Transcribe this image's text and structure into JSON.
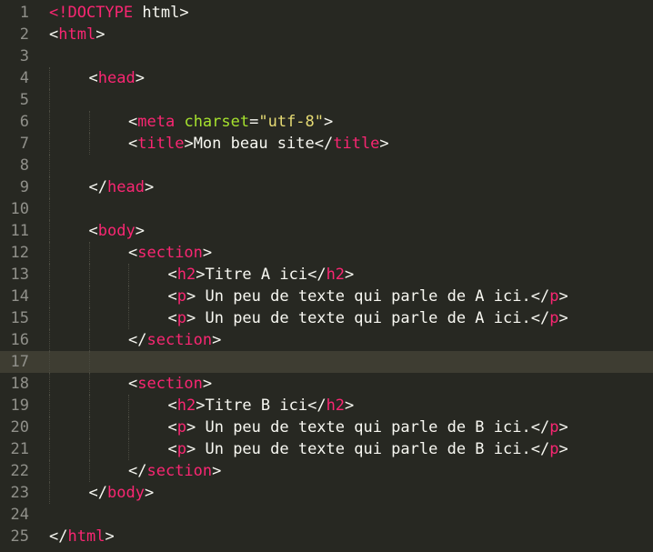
{
  "editor": {
    "active_line": 17,
    "colors": {
      "background": "#272822",
      "gutter_text": "#90908a",
      "tag": "#f92672",
      "attribute": "#a6e22e",
      "string": "#e6db74",
      "text": "#f8f8f2",
      "active_line": "#3e3d32"
    },
    "lines": [
      {
        "n": "1",
        "indent": 0,
        "tokens": [
          [
            "t",
            "<!DOCTYPE"
          ],
          [
            "x",
            " html"
          ],
          [
            "p",
            ">"
          ]
        ]
      },
      {
        "n": "2",
        "indent": 0,
        "tokens": [
          [
            "p",
            "<"
          ],
          [
            "t",
            "html"
          ],
          [
            "p",
            ">"
          ]
        ]
      },
      {
        "n": "3",
        "indent": 0,
        "tokens": []
      },
      {
        "n": "4",
        "indent": 1,
        "tokens": [
          [
            "p",
            "<"
          ],
          [
            "t",
            "head"
          ],
          [
            "p",
            ">"
          ]
        ]
      },
      {
        "n": "5",
        "indent": 1,
        "tokens": []
      },
      {
        "n": "6",
        "indent": 2,
        "tokens": [
          [
            "p",
            "<"
          ],
          [
            "t",
            "meta"
          ],
          [
            "x",
            " "
          ],
          [
            "a",
            "charset"
          ],
          [
            "p",
            "="
          ],
          [
            "s",
            "\"utf-8\""
          ],
          [
            "p",
            ">"
          ]
        ]
      },
      {
        "n": "7",
        "indent": 2,
        "tokens": [
          [
            "p",
            "<"
          ],
          [
            "t",
            "title"
          ],
          [
            "p",
            ">"
          ],
          [
            "x",
            "Mon beau site"
          ],
          [
            "p",
            "</"
          ],
          [
            "t",
            "title"
          ],
          [
            "p",
            ">"
          ]
        ]
      },
      {
        "n": "8",
        "indent": 1,
        "tokens": []
      },
      {
        "n": "9",
        "indent": 1,
        "tokens": [
          [
            "p",
            "</"
          ],
          [
            "t",
            "head"
          ],
          [
            "p",
            ">"
          ]
        ]
      },
      {
        "n": "10",
        "indent": 0,
        "tokens": []
      },
      {
        "n": "11",
        "indent": 1,
        "tokens": [
          [
            "p",
            "<"
          ],
          [
            "t",
            "body"
          ],
          [
            "p",
            ">"
          ]
        ]
      },
      {
        "n": "12",
        "indent": 2,
        "tokens": [
          [
            "p",
            "<"
          ],
          [
            "t",
            "section"
          ],
          [
            "p",
            ">"
          ]
        ]
      },
      {
        "n": "13",
        "indent": 3,
        "tokens": [
          [
            "p",
            "<"
          ],
          [
            "t",
            "h2"
          ],
          [
            "p",
            ">"
          ],
          [
            "x",
            "Titre A ici"
          ],
          [
            "p",
            "</"
          ],
          [
            "t",
            "h2"
          ],
          [
            "p",
            ">"
          ]
        ]
      },
      {
        "n": "14",
        "indent": 3,
        "tokens": [
          [
            "p",
            "<"
          ],
          [
            "t",
            "p"
          ],
          [
            "p",
            ">"
          ],
          [
            "x",
            " Un peu de texte qui parle de A ici."
          ],
          [
            "p",
            "</"
          ],
          [
            "t",
            "p"
          ],
          [
            "p",
            ">"
          ]
        ]
      },
      {
        "n": "15",
        "indent": 3,
        "tokens": [
          [
            "p",
            "<"
          ],
          [
            "t",
            "p"
          ],
          [
            "p",
            ">"
          ],
          [
            "x",
            " Un peu de texte qui parle de A ici."
          ],
          [
            "p",
            "</"
          ],
          [
            "t",
            "p"
          ],
          [
            "p",
            ">"
          ]
        ]
      },
      {
        "n": "16",
        "indent": 2,
        "tokens": [
          [
            "p",
            "</"
          ],
          [
            "t",
            "section"
          ],
          [
            "p",
            ">"
          ]
        ]
      },
      {
        "n": "17",
        "indent": 2,
        "tokens": []
      },
      {
        "n": "18",
        "indent": 2,
        "tokens": [
          [
            "p",
            "<"
          ],
          [
            "t",
            "section"
          ],
          [
            "p",
            ">"
          ]
        ]
      },
      {
        "n": "19",
        "indent": 3,
        "tokens": [
          [
            "p",
            "<"
          ],
          [
            "t",
            "h2"
          ],
          [
            "p",
            ">"
          ],
          [
            "x",
            "Titre B ici"
          ],
          [
            "p",
            "</"
          ],
          [
            "t",
            "h2"
          ],
          [
            "p",
            ">"
          ]
        ]
      },
      {
        "n": "20",
        "indent": 3,
        "tokens": [
          [
            "p",
            "<"
          ],
          [
            "t",
            "p"
          ],
          [
            "p",
            ">"
          ],
          [
            "x",
            " Un peu de texte qui parle de B ici."
          ],
          [
            "p",
            "</"
          ],
          [
            "t",
            "p"
          ],
          [
            "p",
            ">"
          ]
        ]
      },
      {
        "n": "21",
        "indent": 3,
        "tokens": [
          [
            "p",
            "<"
          ],
          [
            "t",
            "p"
          ],
          [
            "p",
            ">"
          ],
          [
            "x",
            " Un peu de texte qui parle de B ici."
          ],
          [
            "p",
            "</"
          ],
          [
            "t",
            "p"
          ],
          [
            "p",
            ">"
          ]
        ]
      },
      {
        "n": "22",
        "indent": 2,
        "tokens": [
          [
            "p",
            "</"
          ],
          [
            "t",
            "section"
          ],
          [
            "p",
            ">"
          ]
        ]
      },
      {
        "n": "23",
        "indent": 1,
        "tokens": [
          [
            "p",
            "</"
          ],
          [
            "t",
            "body"
          ],
          [
            "p",
            ">"
          ]
        ]
      },
      {
        "n": "24",
        "indent": 0,
        "tokens": []
      },
      {
        "n": "25",
        "indent": 0,
        "tokens": [
          [
            "p",
            "</"
          ],
          [
            "t",
            "html"
          ],
          [
            "p",
            ">"
          ]
        ]
      }
    ]
  }
}
